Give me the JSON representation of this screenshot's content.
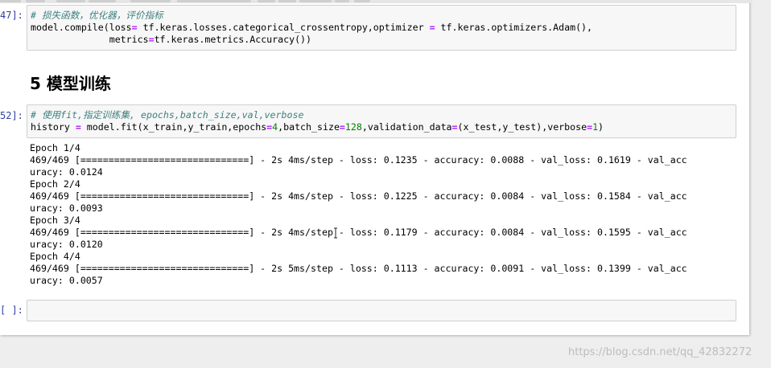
{
  "cell1": {
    "prompt": "47]:",
    "comment": "# 损失函数，优化器，评价指标",
    "line2_a": "model.compile(loss",
    "line2_op": "=",
    "line2_b": " tf.keras.losses.categorical_crossentropy,optimizer ",
    "line2_op2": "=",
    "line2_c": " tf.keras.optimizers.Adam(),",
    "line3_a": "              metrics",
    "line3_op": "=",
    "line3_b": "tf.keras.metrics.Accuracy())"
  },
  "heading": "5 模型训练",
  "cell2": {
    "prompt": "52]:",
    "comment": "# 使用fit,指定训练集, epochs,batch_size,val,verbose",
    "line2_a": "history ",
    "line2_op": "=",
    "line2_b": " model.fit(x_train,y_train,epochs",
    "line2_op2": "=",
    "line2_n1": "4",
    "line2_c": ",batch_size",
    "line2_op3": "=",
    "line2_n2": "128",
    "line2_d": ",validation_data",
    "line2_op4": "=",
    "line2_e": "(x_test,y_test),verbose",
    "line2_op5": "=",
    "line2_n3": "1",
    "line2_f": ")"
  },
  "output_lines": [
    "Epoch 1/4",
    "469/469 [==============================] - 2s 4ms/step - loss: 0.1235 - accuracy: 0.0088 - val_loss: 0.1619 - val_acc",
    "uracy: 0.0124",
    "Epoch 2/4",
    "469/469 [==============================] - 2s 4ms/step - loss: 0.1225 - accuracy: 0.0084 - val_loss: 0.1584 - val_acc",
    "uracy: 0.0093",
    "Epoch 3/4",
    "469/469 [==============================] - 2s 4ms/step - loss: 0.1179 - accuracy: 0.0084 - val_loss: 0.1595 - val_acc",
    "uracy: 0.0120",
    "Epoch 4/4",
    "469/469 [==============================] - 2s 5ms/step - loss: 0.1113 - accuracy: 0.0091 - val_loss: 0.1399 - val_acc",
    "uracy: 0.0057"
  ],
  "cell3": {
    "prompt": "[ ]:"
  },
  "watermark": "https://blog.csdn.net/qq_42832272",
  "colors": {
    "prompt": "#303f9f",
    "comment": "#408080",
    "operator": "#aa22ff",
    "number": "#008000"
  }
}
